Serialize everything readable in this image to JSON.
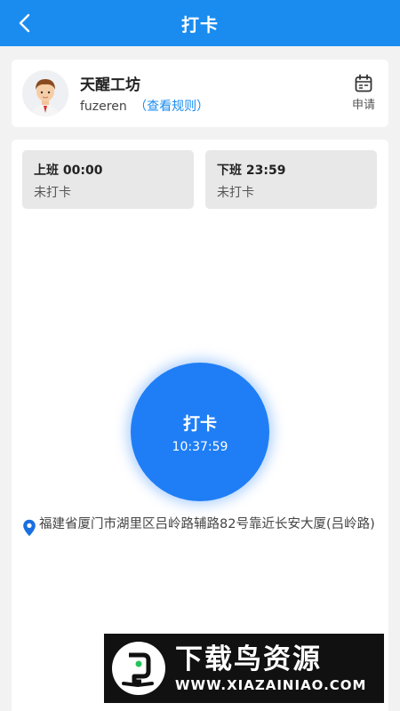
{
  "header": {
    "title": "打卡",
    "back_icon": "chevron-left-icon",
    "background_color": "#1a8cf0"
  },
  "profile": {
    "company": "天醒工坊",
    "username": "fuzeren",
    "rules_link": "（查看规则）",
    "apply_label": "申请",
    "apply_icon": "calendar-icon"
  },
  "shifts": [
    {
      "title": "上班 00:00",
      "status": "未打卡"
    },
    {
      "title": "下班 23:59",
      "status": "未打卡"
    }
  ],
  "clock_button": {
    "label": "打卡",
    "time": "10:37:59",
    "color": "#1f7ef5"
  },
  "location": {
    "icon": "map-pin-icon",
    "address": "福建省厦门市湖里区吕岭路辅路82号靠近长安大厦(吕岭路)"
  },
  "watermark": {
    "title": "下载鸟资源",
    "url": "WWW.XIAZAINIAO.COM"
  }
}
